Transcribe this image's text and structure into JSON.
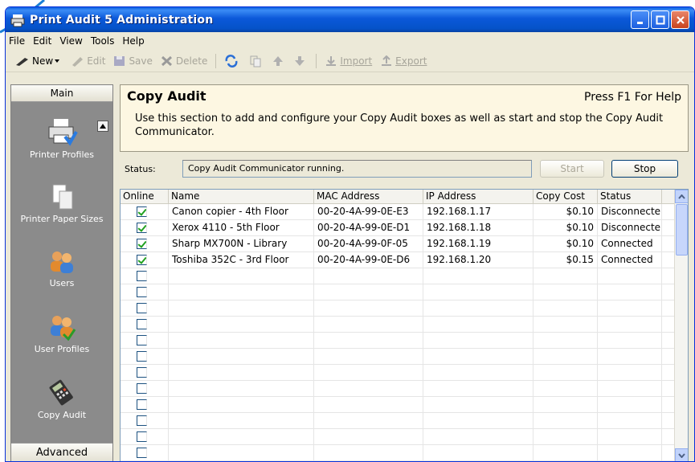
{
  "window": {
    "title": "Print Audit 5 Administration"
  },
  "menu": [
    "File",
    "Edit",
    "View",
    "Tools",
    "Help"
  ],
  "toolbar": {
    "new": "New",
    "edit": "Edit",
    "save": "Save",
    "delete": "Delete",
    "import": "Import",
    "export": "Export"
  },
  "nav": {
    "header": "Main",
    "footer": "Advanced",
    "items": [
      "Printer Profiles",
      "Printer Paper Sizes",
      "Users",
      "User Profiles",
      "Copy Audit"
    ]
  },
  "page": {
    "title": "Copy Audit",
    "help": "Press F1 For Help",
    "description": "Use this section to add and configure your Copy Audit boxes as well as start and stop the Copy Audit Communicator."
  },
  "status": {
    "label": "Status:",
    "value": "Copy Audit Communicator running.",
    "start_label": "Start",
    "stop_label": "Stop"
  },
  "grid": {
    "columns": [
      "Online",
      "Name",
      "MAC Address",
      "IP Address",
      "Copy Cost",
      "Status"
    ],
    "rows": [
      {
        "online": true,
        "name": "Canon copier - 4th Floor",
        "mac": "00-20-4A-99-0E-E3",
        "ip": "192.168.1.17",
        "cost": "$0.10",
        "status": "Disconnecte"
      },
      {
        "online": true,
        "name": "Xerox 4110 - 5th Floor",
        "mac": "00-20-4A-99-0E-D1",
        "ip": "192.168.1.18",
        "cost": "$0.10",
        "status": "Disconnecte"
      },
      {
        "online": true,
        "name": "Sharp MX700N - Library",
        "mac": "00-20-4A-99-0F-05",
        "ip": "192.168.1.19",
        "cost": "$0.10",
        "status": "Connected"
      },
      {
        "online": true,
        "name": "Toshiba 352C - 3rd Floor",
        "mac": "00-20-4A-99-0E-D6",
        "ip": "192.168.1.20",
        "cost": "$0.15",
        "status": "Connected"
      }
    ],
    "empty_rows": 12
  },
  "colors": {
    "titlebar": "#0b58d9",
    "nav_bg": "#8b8b8b",
    "header_bg": "#fdf7e2"
  }
}
